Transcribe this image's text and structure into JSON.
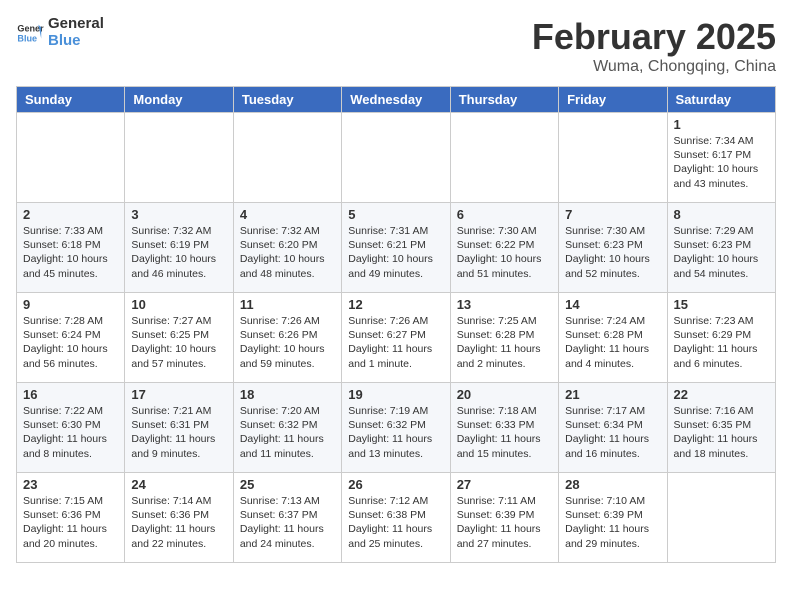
{
  "header": {
    "logo_line1": "General",
    "logo_line2": "Blue",
    "month": "February 2025",
    "location": "Wuma, Chongqing, China"
  },
  "days_of_week": [
    "Sunday",
    "Monday",
    "Tuesday",
    "Wednesday",
    "Thursday",
    "Friday",
    "Saturday"
  ],
  "weeks": [
    [
      {
        "day": "",
        "info": ""
      },
      {
        "day": "",
        "info": ""
      },
      {
        "day": "",
        "info": ""
      },
      {
        "day": "",
        "info": ""
      },
      {
        "day": "",
        "info": ""
      },
      {
        "day": "",
        "info": ""
      },
      {
        "day": "1",
        "info": "Sunrise: 7:34 AM\nSunset: 6:17 PM\nDaylight: 10 hours and 43 minutes."
      }
    ],
    [
      {
        "day": "2",
        "info": "Sunrise: 7:33 AM\nSunset: 6:18 PM\nDaylight: 10 hours and 45 minutes."
      },
      {
        "day": "3",
        "info": "Sunrise: 7:32 AM\nSunset: 6:19 PM\nDaylight: 10 hours and 46 minutes."
      },
      {
        "day": "4",
        "info": "Sunrise: 7:32 AM\nSunset: 6:20 PM\nDaylight: 10 hours and 48 minutes."
      },
      {
        "day": "5",
        "info": "Sunrise: 7:31 AM\nSunset: 6:21 PM\nDaylight: 10 hours and 49 minutes."
      },
      {
        "day": "6",
        "info": "Sunrise: 7:30 AM\nSunset: 6:22 PM\nDaylight: 10 hours and 51 minutes."
      },
      {
        "day": "7",
        "info": "Sunrise: 7:30 AM\nSunset: 6:23 PM\nDaylight: 10 hours and 52 minutes."
      },
      {
        "day": "8",
        "info": "Sunrise: 7:29 AM\nSunset: 6:23 PM\nDaylight: 10 hours and 54 minutes."
      }
    ],
    [
      {
        "day": "9",
        "info": "Sunrise: 7:28 AM\nSunset: 6:24 PM\nDaylight: 10 hours and 56 minutes."
      },
      {
        "day": "10",
        "info": "Sunrise: 7:27 AM\nSunset: 6:25 PM\nDaylight: 10 hours and 57 minutes."
      },
      {
        "day": "11",
        "info": "Sunrise: 7:26 AM\nSunset: 6:26 PM\nDaylight: 10 hours and 59 minutes."
      },
      {
        "day": "12",
        "info": "Sunrise: 7:26 AM\nSunset: 6:27 PM\nDaylight: 11 hours and 1 minute."
      },
      {
        "day": "13",
        "info": "Sunrise: 7:25 AM\nSunset: 6:28 PM\nDaylight: 11 hours and 2 minutes."
      },
      {
        "day": "14",
        "info": "Sunrise: 7:24 AM\nSunset: 6:28 PM\nDaylight: 11 hours and 4 minutes."
      },
      {
        "day": "15",
        "info": "Sunrise: 7:23 AM\nSunset: 6:29 PM\nDaylight: 11 hours and 6 minutes."
      }
    ],
    [
      {
        "day": "16",
        "info": "Sunrise: 7:22 AM\nSunset: 6:30 PM\nDaylight: 11 hours and 8 minutes."
      },
      {
        "day": "17",
        "info": "Sunrise: 7:21 AM\nSunset: 6:31 PM\nDaylight: 11 hours and 9 minutes."
      },
      {
        "day": "18",
        "info": "Sunrise: 7:20 AM\nSunset: 6:32 PM\nDaylight: 11 hours and 11 minutes."
      },
      {
        "day": "19",
        "info": "Sunrise: 7:19 AM\nSunset: 6:32 PM\nDaylight: 11 hours and 13 minutes."
      },
      {
        "day": "20",
        "info": "Sunrise: 7:18 AM\nSunset: 6:33 PM\nDaylight: 11 hours and 15 minutes."
      },
      {
        "day": "21",
        "info": "Sunrise: 7:17 AM\nSunset: 6:34 PM\nDaylight: 11 hours and 16 minutes."
      },
      {
        "day": "22",
        "info": "Sunrise: 7:16 AM\nSunset: 6:35 PM\nDaylight: 11 hours and 18 minutes."
      }
    ],
    [
      {
        "day": "23",
        "info": "Sunrise: 7:15 AM\nSunset: 6:36 PM\nDaylight: 11 hours and 20 minutes."
      },
      {
        "day": "24",
        "info": "Sunrise: 7:14 AM\nSunset: 6:36 PM\nDaylight: 11 hours and 22 minutes."
      },
      {
        "day": "25",
        "info": "Sunrise: 7:13 AM\nSunset: 6:37 PM\nDaylight: 11 hours and 24 minutes."
      },
      {
        "day": "26",
        "info": "Sunrise: 7:12 AM\nSunset: 6:38 PM\nDaylight: 11 hours and 25 minutes."
      },
      {
        "day": "27",
        "info": "Sunrise: 7:11 AM\nSunset: 6:39 PM\nDaylight: 11 hours and 27 minutes."
      },
      {
        "day": "28",
        "info": "Sunrise: 7:10 AM\nSunset: 6:39 PM\nDaylight: 11 hours and 29 minutes."
      },
      {
        "day": "",
        "info": ""
      }
    ]
  ]
}
